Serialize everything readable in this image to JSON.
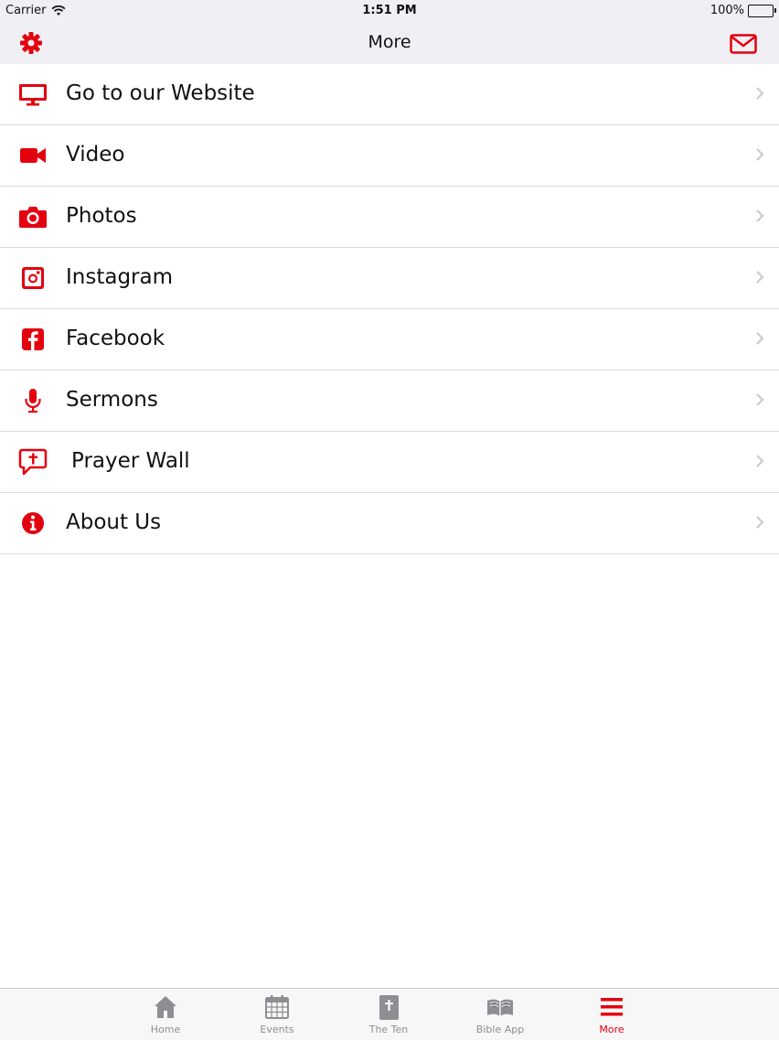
{
  "status_bar": {
    "carrier": "Carrier",
    "time": "1:51 PM",
    "battery": "100%"
  },
  "nav": {
    "title": "More",
    "left_icon": "gear-icon",
    "right_icon": "mail-icon"
  },
  "colors": {
    "accent": "#e3000f",
    "tab_inactive": "#8e8e93"
  },
  "menu": {
    "items": [
      {
        "label": "Go to our Website",
        "icon": "monitor-icon"
      },
      {
        "label": "Video",
        "icon": "video-camera-icon"
      },
      {
        "label": "Photos",
        "icon": "camera-icon"
      },
      {
        "label": "Instagram",
        "icon": "instagram-icon"
      },
      {
        "label": "Facebook",
        "icon": "facebook-icon"
      },
      {
        "label": "Sermons",
        "icon": "microphone-icon"
      },
      {
        "label": "Prayer Wall",
        "icon": "prayer-bubble-icon"
      },
      {
        "label": "About Us",
        "icon": "info-icon"
      }
    ]
  },
  "tabs": [
    {
      "label": "Home",
      "icon": "home-icon",
      "active": false
    },
    {
      "label": "Events",
      "icon": "calendar-icon",
      "active": false
    },
    {
      "label": "The Ten",
      "icon": "bible-icon",
      "active": false
    },
    {
      "label": "Bible App",
      "icon": "open-book-icon",
      "active": false
    },
    {
      "label": "More",
      "icon": "menu-icon",
      "active": true
    }
  ]
}
